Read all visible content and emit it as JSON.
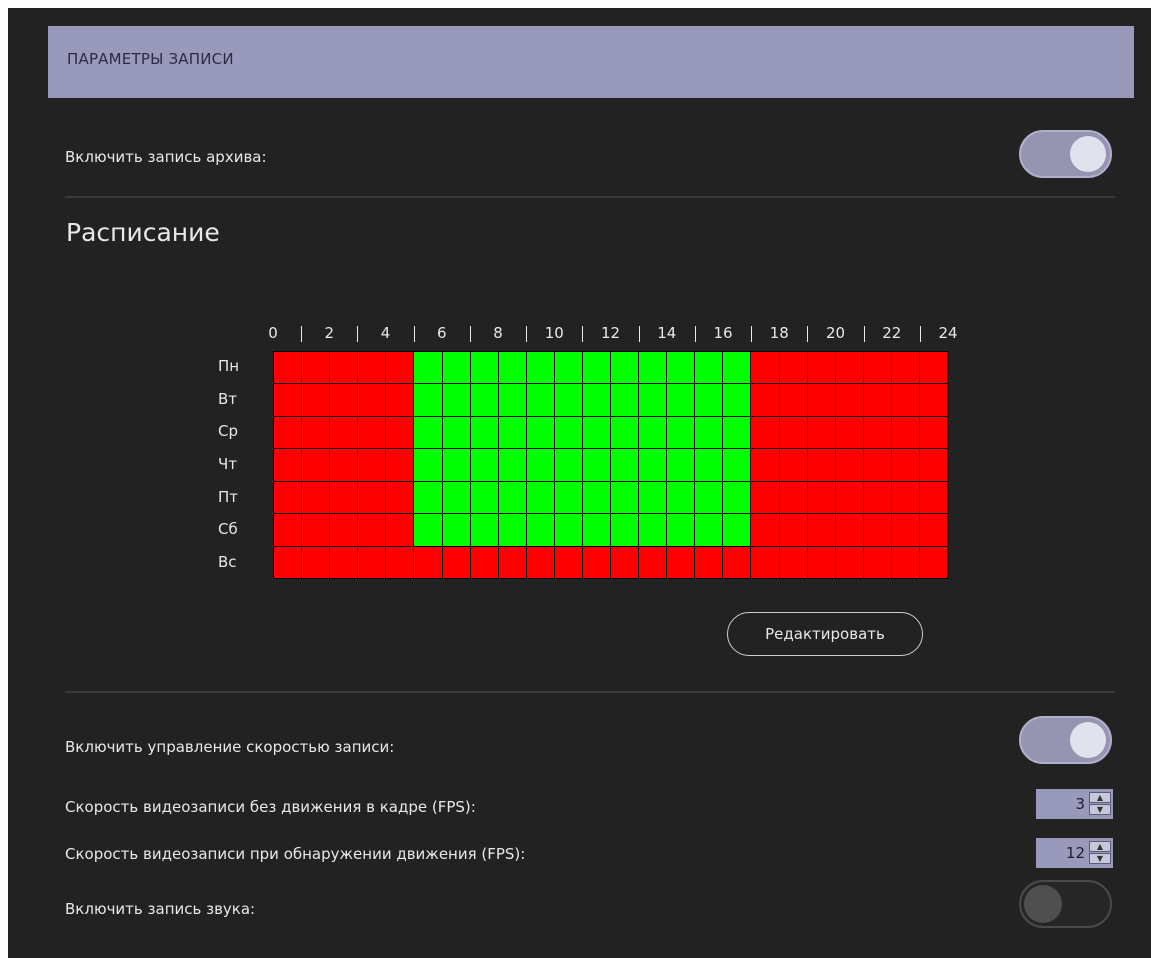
{
  "header": {
    "title": "ПАРАМЕТРЫ ЗАПИСИ"
  },
  "archive": {
    "label": "Включить запись архива:",
    "enabled": true
  },
  "schedule": {
    "title": "Расписание",
    "hours": [
      "0",
      "2",
      "4",
      "6",
      "8",
      "10",
      "12",
      "14",
      "16",
      "18",
      "20",
      "22",
      "24"
    ],
    "days": [
      "Пн",
      "Вт",
      "Ср",
      "Чт",
      "Пт",
      "Сб",
      "Вс"
    ],
    "active": [
      [
        5,
        17
      ],
      [
        5,
        17
      ],
      [
        5,
        17
      ],
      [
        5,
        17
      ],
      [
        5,
        17
      ],
      [
        5,
        17
      ],
      []
    ],
    "colors": {
      "active": "#00ff00",
      "inactive": "#ff0000"
    },
    "edit_label": "Редактировать"
  },
  "speed_control": {
    "label": "Включить управление скоростью записи:",
    "enabled": true
  },
  "fps_no_motion": {
    "label": "Скорость видеозаписи без движения в кадре (FPS):",
    "value": "3"
  },
  "fps_motion": {
    "label": "Скорость видеозаписи при обнаружении движения (FPS):",
    "value": "12"
  },
  "audio": {
    "label": "Включить запись звука:",
    "enabled": false
  }
}
